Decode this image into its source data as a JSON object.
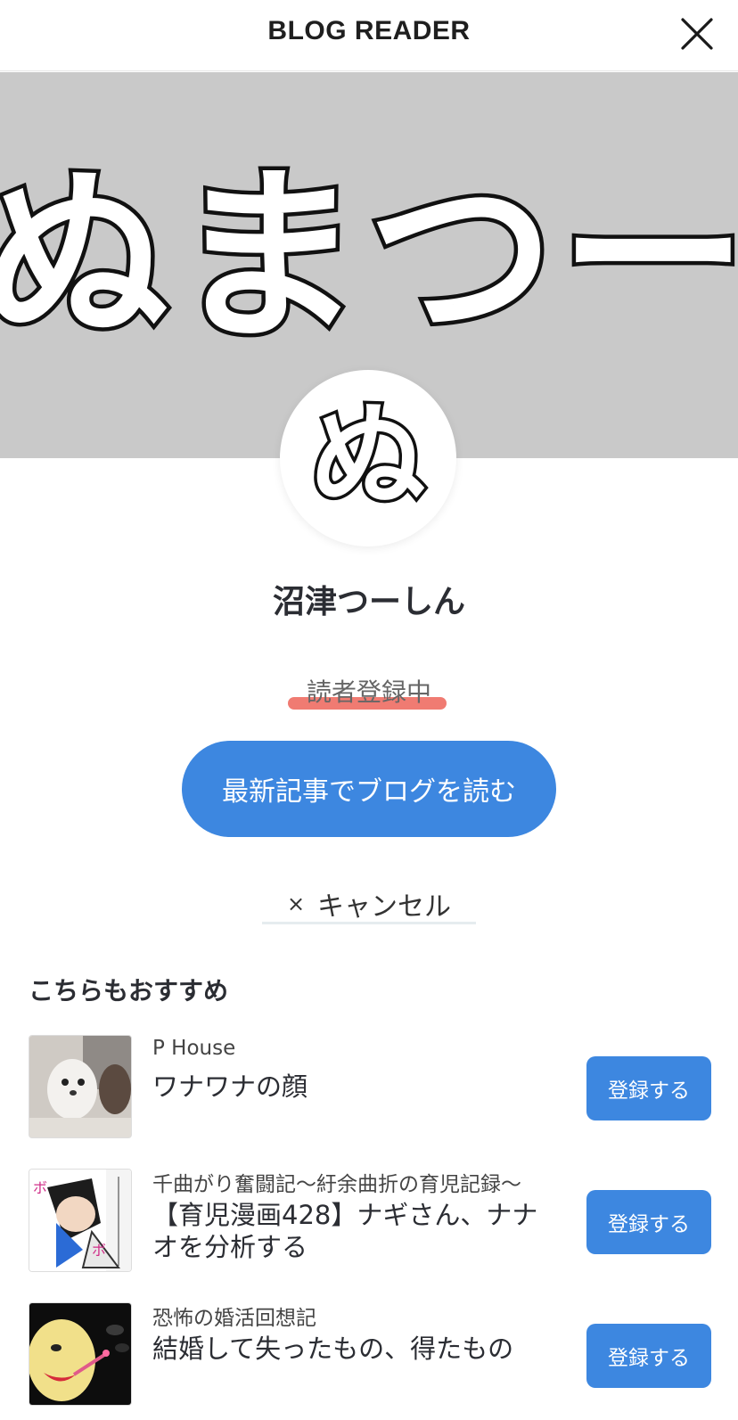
{
  "header": {
    "title": "BLOG READER",
    "close_icon": "close-icon"
  },
  "cover": {
    "text": "ぬまつー（仮"
  },
  "avatar": {
    "text": "ぬ"
  },
  "blog": {
    "name": "沼津つーしん"
  },
  "status": {
    "label": "読者登録中",
    "accent_color": "#ee6d63"
  },
  "actions": {
    "read_label": "最新記事でブログを読む",
    "cancel_label": "キャンセル",
    "cancel_icon": "×"
  },
  "recommend": {
    "heading": "こちらもおすすめ",
    "items": [
      {
        "blog": "P House",
        "title": "ワナワナの顔",
        "button": "登録する"
      },
      {
        "blog": "千曲がり奮闘記〜紆余曲折の育児記録〜",
        "title": "【育児漫画428】ナギさん、ナナオを分析する",
        "button": "登録する"
      },
      {
        "blog": "恐怖の婚活回想記",
        "title": "結婚して失ったもの、得たもの",
        "button": "登録する"
      }
    ]
  },
  "colors": {
    "primary": "#3d87e0",
    "cover_bg": "#c9c9c9"
  }
}
